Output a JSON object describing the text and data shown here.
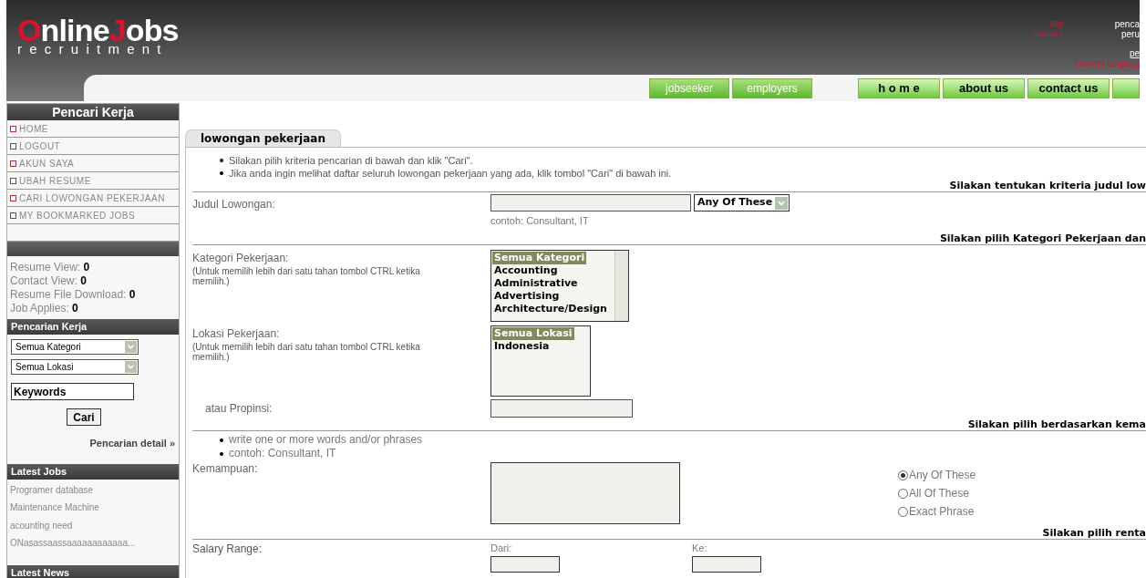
{
  "header": {
    "logo": {
      "words": [
        "Online",
        "Jobs"
      ],
      "tagline": "recruitment"
    },
    "site_stats": {
      "label_lines": [
        "Site",
        "statistics"
      ],
      "values": [
        "penca",
        "peru"
      ],
      "link": "pe",
      "current_language": "Current languag"
    },
    "portal_tabs": [
      {
        "label": "jobseeker"
      },
      {
        "label": "employers"
      }
    ],
    "nav_tabs": [
      {
        "label": "h o m e"
      },
      {
        "label": "about us"
      },
      {
        "label": "contact us"
      }
    ]
  },
  "sidebar": {
    "title": "Pencari Kerja",
    "menu": [
      "HOME",
      "LOGOUT",
      "AKUN SAYA",
      "UBAH RESUME",
      "CARI LOWONGAN PEKERJAAN",
      "MY BOOKMARKED JOBS"
    ],
    "stats": [
      {
        "label": "Resume View:",
        "value": "0"
      },
      {
        "label": "Contact View:",
        "value": "0"
      },
      {
        "label": "Resume File Download:",
        "value": "0"
      },
      {
        "label": "Job Applies:",
        "value": "0"
      }
    ],
    "search": {
      "title": "Pencarian Kerja",
      "selects": [
        "Semua Kategori",
        "Semua Lokasi"
      ],
      "keywords": "Keywords",
      "button": "Cari",
      "detail_link": "Pencarian detail »"
    },
    "latest_jobs": {
      "title": "Latest Jobs",
      "items": [
        "Programer database",
        "Maintenance Machine",
        "acounting need",
        "ONasassaassaaaaaaaaaaaa..."
      ]
    },
    "latest_news": {
      "title": "Latest News"
    }
  },
  "main": {
    "tab": "lowongan pekerjaan",
    "instructions": [
      "Silakan pilih kriteria pencarian di bawah dan klik \"Cari\".",
      "Jika anda ingin melihat daftar seluruh lowongan pekerjaan yang ada, klik tombol \"Cari\" di bawah ini."
    ],
    "title_section": {
      "heading": "Silakan tentukan kriteria judul low",
      "label": "Judul Lowongan:",
      "match_select": "Any Of These",
      "hint": "contoh: Consultant, IT"
    },
    "category_section": {
      "heading": "Silakan pilih Kategori Pekerjaan dan",
      "category": {
        "label": "Kategori Pekerjaan:",
        "note": "(Untuk memilih lebih dari satu tahan tombol CTRL ketika memilih.)",
        "options": [
          {
            "text": "Semua Kategori",
            "selected": true
          },
          {
            "text": "Accounting",
            "selected": false
          },
          {
            "text": "Administrative",
            "selected": false
          },
          {
            "text": "Advertising",
            "selected": false
          },
          {
            "text": "Architecture/Design",
            "selected": false
          }
        ]
      },
      "location": {
        "label": "Lokasi Pekerjaan:",
        "note": "(Untuk memilih lebih dari satu tahan tombol CTRL ketika memilih.)",
        "options": [
          {
            "text": "Semua Lokasi",
            "selected": true
          },
          {
            "text": "Indonesia",
            "selected": false
          }
        ]
      },
      "province_label": "atau Propinsi:"
    },
    "skills_section": {
      "heading": "Silakan pilih berdasarkan kema",
      "tips": [
        "write one or more words and/or phrases",
        "contoh: Consultant, IT"
      ],
      "label": "Kemampuan:",
      "match_options": [
        {
          "text": "Any Of These",
          "selected": true
        },
        {
          "text": "All Of These",
          "selected": false
        },
        {
          "text": "Exact Phrase",
          "selected": false
        }
      ]
    },
    "salary_section": {
      "heading": "Silakan pilih renta",
      "label": "Salary Range:",
      "from_label": "Dari:",
      "to_label": "Ke:"
    }
  }
}
